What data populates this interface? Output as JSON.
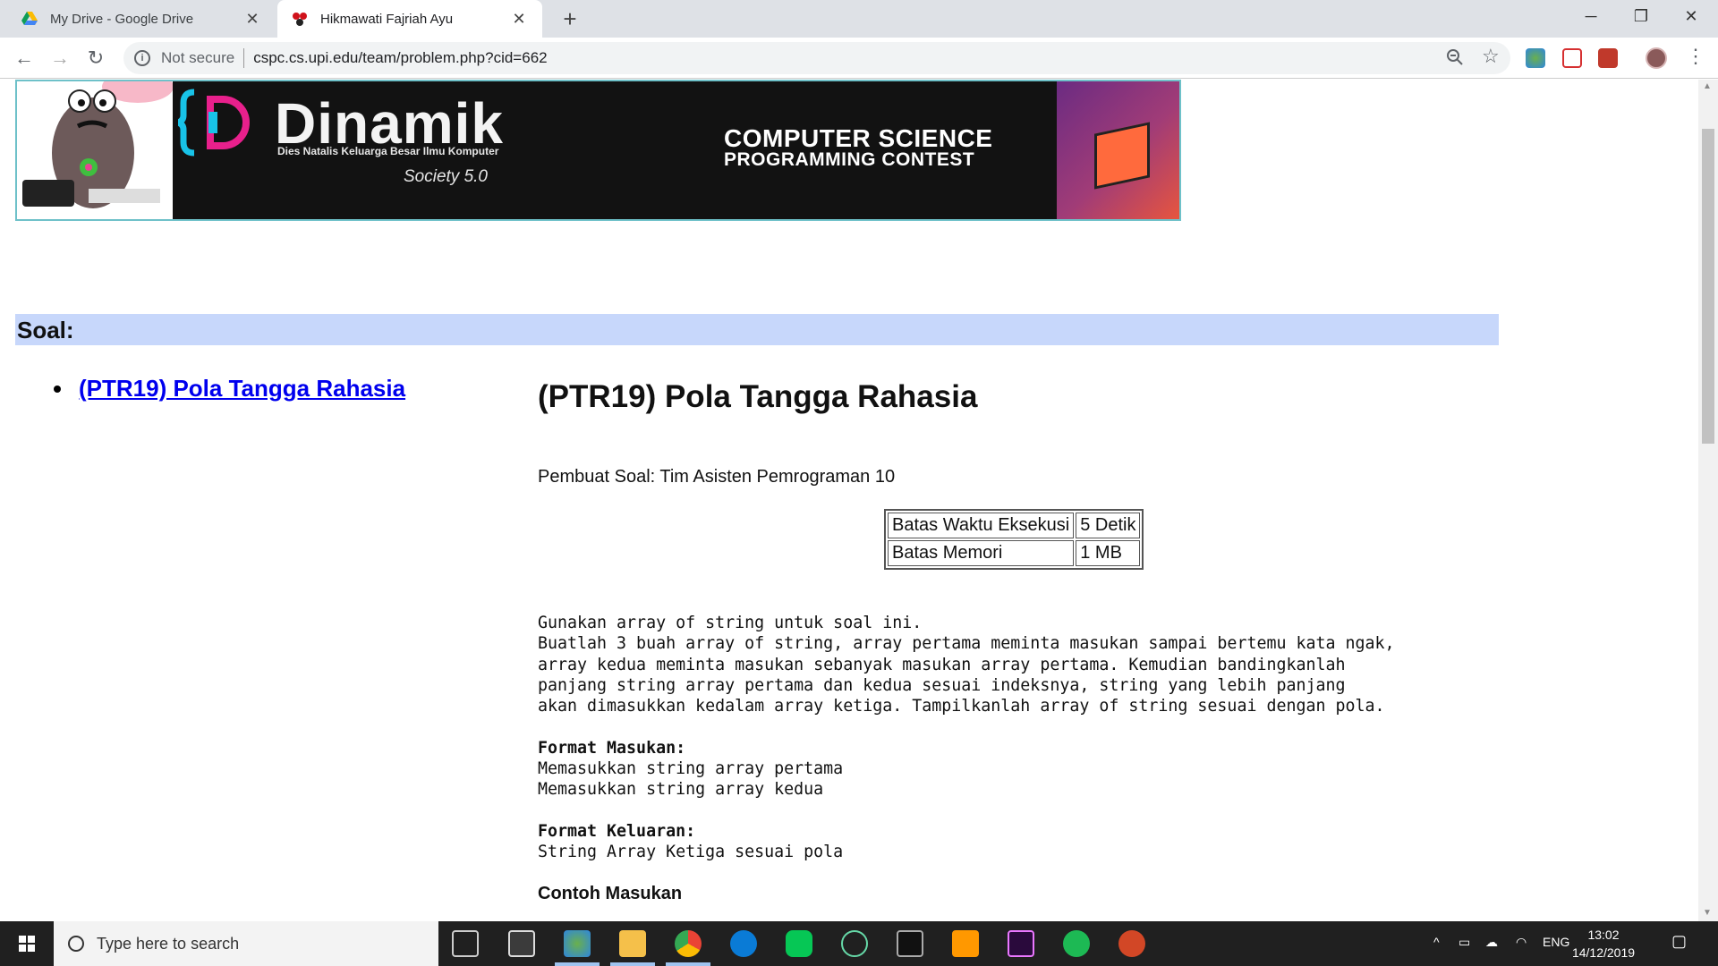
{
  "browser": {
    "tabs": [
      {
        "title": "My Drive - Google Drive",
        "active": false
      },
      {
        "title": "Hikmawati Fajriah Ayu",
        "active": true
      }
    ],
    "new_tab": "+",
    "window_controls": {
      "minimize": "─",
      "maximize": "❐",
      "close": "✕"
    },
    "nav": {
      "back": "←",
      "forward": "→",
      "reload": "↻"
    },
    "address": {
      "security": "Not secure",
      "url": "cspc.cs.upi.edu/team/problem.php?cid=662"
    },
    "omnibox_icons": [
      "zoom-icon",
      "star-icon"
    ]
  },
  "banner": {
    "brand": "Dinamik",
    "brand_symbol": "{D}",
    "tagline": "Dies Natalis Keluarga Besar Ilmu Komputer",
    "society": "Society 5.0",
    "contest_line1": "COMPUTER SCIENCE",
    "contest_line2": "PROGRAMMING CONTEST"
  },
  "page": {
    "section_title": "Soal:",
    "problem_list": [
      "(PTR19) Pola Tangga Rahasia"
    ],
    "problem": {
      "title": "(PTR19) Pola Tangga Rahasia",
      "author": "Pembuat Soal: Tim Asisten Pemrograman 10",
      "limits": [
        {
          "label": "Batas Waktu Eksekusi",
          "value": "5 Detik"
        },
        {
          "label": "Batas Memori",
          "value": "1 MB"
        }
      ],
      "description": [
        "Gunakan array of string untuk soal ini.",
        "Buatlah 3 buah array of string, array pertama meminta masukan sampai bertemu kata ngak,",
        "array kedua meminta masukan sebanyak masukan array pertama. Kemudian bandingkanlah",
        "panjang string array pertama dan kedua sesuai indeksnya, string yang lebih panjang",
        "akan dimasukkan kedalam array ketiga. Tampilkanlah array of string sesuai dengan pola."
      ],
      "input_format_title": "Format Masukan:",
      "input_format_lines": [
        "Memasukkan string array pertama",
        "Memasukkan string array kedua"
      ],
      "output_format_title": "Format Keluaran:",
      "output_format_lines": [
        "String Array Ketiga sesuai pola"
      ],
      "example_title": "Contoh Masukan"
    }
  },
  "taskbar": {
    "search_placeholder": "Type here to search",
    "time": "13:02",
    "date": "14/12/2019",
    "language": "ENG",
    "apps": [
      "task-view-icon",
      "store-icon",
      "browser-icon",
      "file-explorer-icon",
      "chrome-icon",
      "edge-icon",
      "line-icon",
      "atom-icon",
      "terminal-icon",
      "sublime-icon",
      "premiere-icon",
      "spotify-icon",
      "powerpoint-icon"
    ]
  },
  "colors": {
    "link": "#0000ee",
    "section_bar": "#c7d7fb",
    "banner_border": "#6ec1c9",
    "taskbar": "#202020"
  }
}
